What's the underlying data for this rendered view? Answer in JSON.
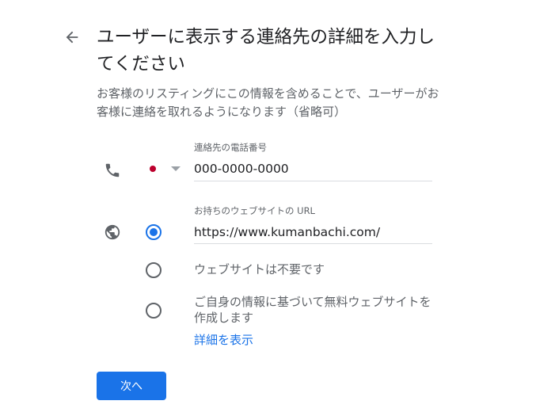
{
  "page": {
    "title": "ユーザーに表示する連絡先の詳細を入力してください",
    "subtitle": "お客様のリスティングにこの情報を含めることで、ユーザーがお客様に連絡を取れるようになります（省略可）"
  },
  "phone": {
    "label": "連絡先の電話番号",
    "value": "000-0000-0000",
    "country_flag_color": "#bc002d",
    "icon": "phone-icon"
  },
  "website": {
    "label": "お持ちのウェブサイトの URL",
    "value": "https://www.kumanbachi.com/",
    "icon": "globe-icon",
    "options": [
      {
        "label": "",
        "selected": true
      },
      {
        "label": "ウェブサイトは不要です",
        "selected": false
      },
      {
        "label": "ご自身の情報に基づいて無料ウェブサイトを作成します",
        "selected": false
      }
    ],
    "learn_more": "詳細を表示"
  },
  "actions": {
    "next_label": "次へ"
  },
  "colors": {
    "accent": "#1a73e8",
    "text_primary": "#202124",
    "text_secondary": "#5f6368"
  }
}
